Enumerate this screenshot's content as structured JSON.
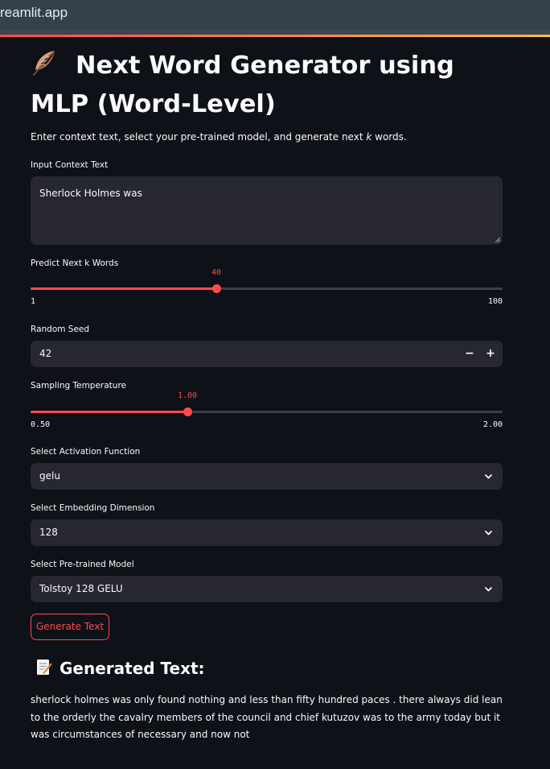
{
  "browser": {
    "url": "reamlit.app"
  },
  "page": {
    "title": "Next Word Generator using MLP (Word-Level)",
    "title_icon": "feather-icon",
    "subtitle_pre": "Enter context text, select your pre-trained model, and generate next ",
    "subtitle_k": "k",
    "subtitle_post": " words."
  },
  "context": {
    "label": "Input Context Text",
    "value": "Sherlock Holmes was"
  },
  "k_slider": {
    "label": "Predict Next k Words",
    "value": "40",
    "min": "1",
    "max": "100",
    "fraction": 0.394
  },
  "seed": {
    "label": "Random Seed",
    "value": "42",
    "minus": "−",
    "plus": "+"
  },
  "temp_slider": {
    "label": "Sampling Temperature",
    "value": "1.00",
    "min": "0.50",
    "max": "2.00",
    "fraction": 0.333
  },
  "activation": {
    "label": "Select Activation Function",
    "value": "gelu"
  },
  "embedding": {
    "label": "Select Embedding Dimension",
    "value": "128"
  },
  "model": {
    "label": "Select Pre-trained Model",
    "value": "Tolstoy 128 GELU"
  },
  "generate_button": {
    "label": "Generate Text"
  },
  "output": {
    "heading": "Generated Text:",
    "heading_icon": "memo-icon",
    "text": "sherlock holmes was only found nothing and less than fifty hundred paces . there always did lean to the orderly the cavalry members of the council and chief kutuzov was to the army today but it was circumstances of necessary and now not"
  },
  "colors": {
    "accent": "#ff4b4b",
    "background": "#0e1117",
    "widget": "#262730"
  }
}
